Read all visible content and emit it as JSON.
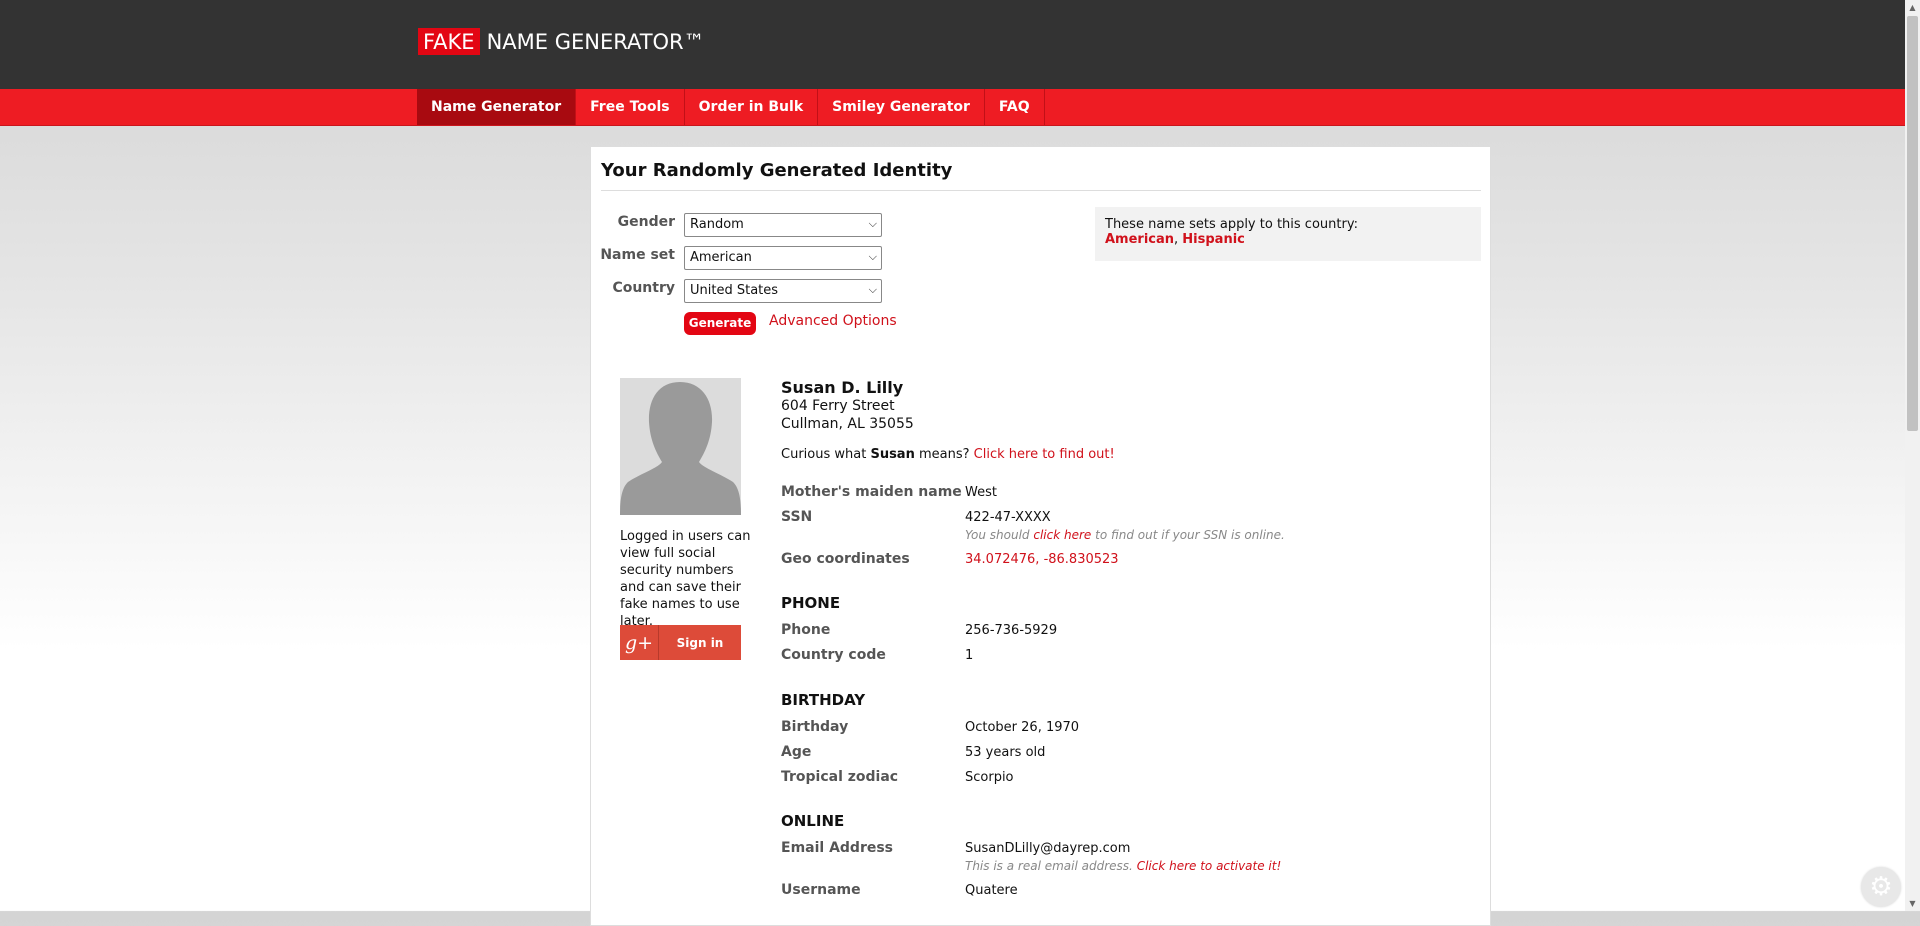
{
  "logo": {
    "fake": "FAKE",
    "rest": "NAME GENERATOR™"
  },
  "nav": [
    {
      "label": "Name Generator",
      "active": true
    },
    {
      "label": "Free Tools"
    },
    {
      "label": "Order in Bulk"
    },
    {
      "label": "Smiley Generator"
    },
    {
      "label": "FAQ"
    }
  ],
  "page_title": "Your Randomly Generated Identity",
  "form": {
    "gender_label": "Gender",
    "gender_value": "Random",
    "nameset_label": "Name set",
    "nameset_value": "American",
    "country_label": "Country",
    "country_value": "United States",
    "generate_label": "Generate",
    "advanced_label": "Advanced Options"
  },
  "country_box": {
    "text": "These name sets apply to this country:",
    "set1": "American",
    "sep": ", ",
    "set2": "Hispanic"
  },
  "sidebar": {
    "login_text": "Logged in users can view full social security numbers and can save their fake names to use later.",
    "signin_label": "Sign in",
    "gplus_glyph": "g+"
  },
  "identity": {
    "name": "Susan D. Lilly",
    "street": "604 Ferry Street",
    "city": "Cullman, AL 35055",
    "curious_prefix": "Curious what",
    "first_name": "Susan",
    "curious_suffix": "means?",
    "curious_link": "Click here to find out!",
    "maiden_label": "Mother's maiden name",
    "maiden_value": "West",
    "ssn_label": "SSN",
    "ssn_value": "422-47-XXXX",
    "ssn_note_prefix": "You should",
    "ssn_note_link": "click here",
    "ssn_note_suffix": "to find out if your SSN is online.",
    "geo_label": "Geo coordinates",
    "geo_value": "34.072476, -86.830523",
    "phone_section": "PHONE",
    "phone_label": "Phone",
    "phone_value": "256-736-5929",
    "cc_label": "Country code",
    "cc_value": "1",
    "birthday_section": "BIRTHDAY",
    "bday_label": "Birthday",
    "bday_value": "October 26, 1970",
    "age_label": "Age",
    "age_value": "53 years old",
    "zodiac_label": "Tropical zodiac",
    "zodiac_value": "Scorpio",
    "online_section": "ONLINE",
    "email_label": "Email Address",
    "email_value": "SusanDLilly@dayrep.com",
    "email_note_prefix": "This is a real email address.",
    "email_note_link": "Click here to activate it!",
    "username_label": "Username",
    "username_value": "Quatere"
  },
  "icons": {
    "select_chevron": "chevron-down-icon",
    "settings": "gear-icon"
  }
}
